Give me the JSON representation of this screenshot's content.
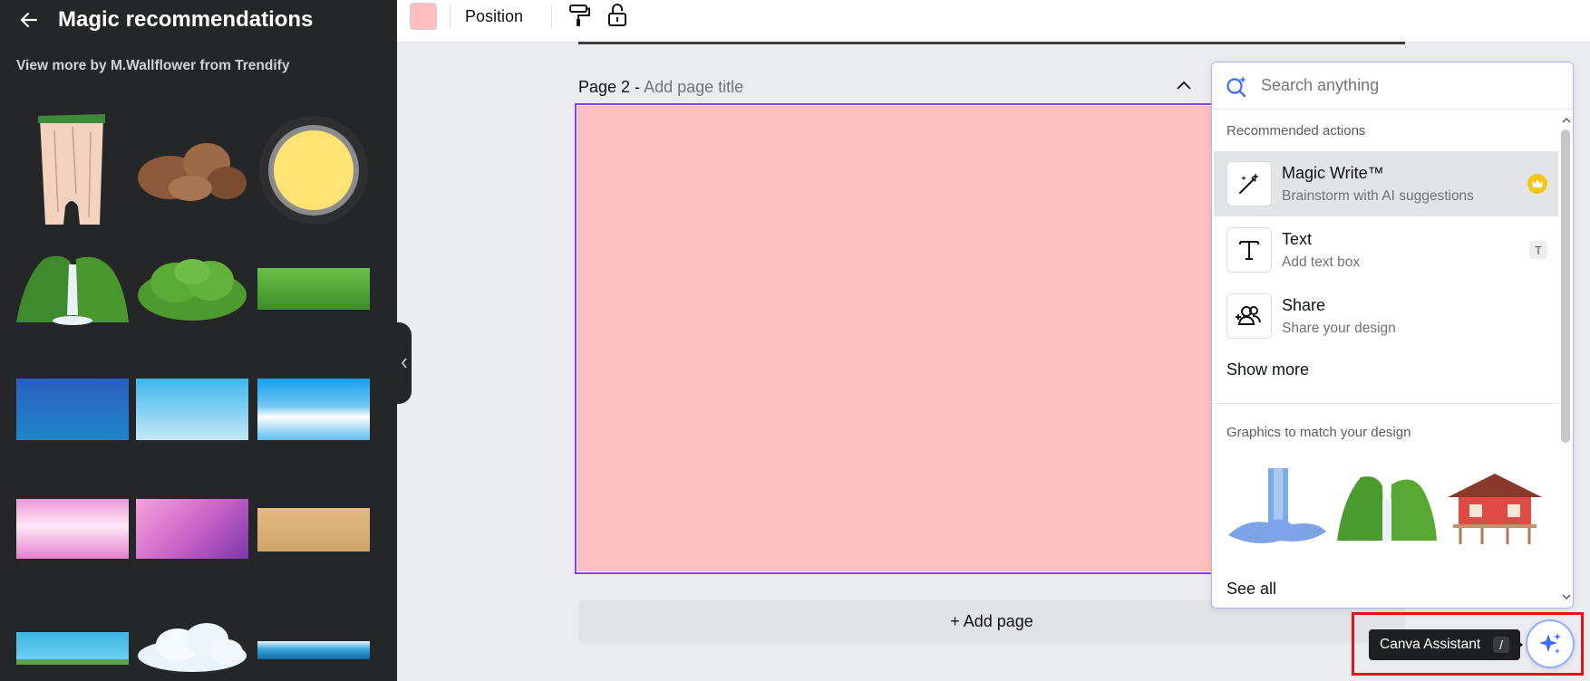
{
  "sidebar": {
    "title": "Magic recommendations",
    "subtitle": "View more by M.Wallflower from Trendify",
    "thumbnails": [
      "cliff-rock",
      "brown-rocks",
      "yellow-sun",
      "green-waterfall",
      "green-bush",
      "grass-strip",
      "deep-blue-gradient",
      "light-blue-gradient",
      "sky-blue-clouds",
      "pink-gradient",
      "purple-pink-gradient",
      "sand-texture",
      "water-pond",
      "white-cloud",
      "ocean-wave"
    ]
  },
  "toolbar": {
    "swatch_color": "#ffbfc0",
    "position_label": "Position"
  },
  "canvas": {
    "page_label": "Page 2 -",
    "page_title_placeholder": "Add page title",
    "page_color": "#ffbfc0",
    "add_page_label": "+ Add page"
  },
  "assistant": {
    "search_placeholder": "Search anything",
    "recommended_title": "Recommended actions",
    "actions": [
      {
        "title": "Magic Write™",
        "subtitle": "Brainstorm with AI suggestions",
        "badge": "crown"
      },
      {
        "title": "Text",
        "subtitle": "Add text box",
        "shortcut": "T"
      },
      {
        "title": "Share",
        "subtitle": "Share your design"
      }
    ],
    "show_more_label": "Show more",
    "graphics_title": "Graphics to match your design",
    "graphics": [
      "blue-waterfall",
      "green-cliffs",
      "stilt-house"
    ],
    "see_all_label": "See all"
  },
  "assistant_button": {
    "tooltip_label": "Canva Assistant",
    "tooltip_shortcut": "/",
    "accent_color": "#3b6cff",
    "highlight_color": "#e3131c"
  }
}
